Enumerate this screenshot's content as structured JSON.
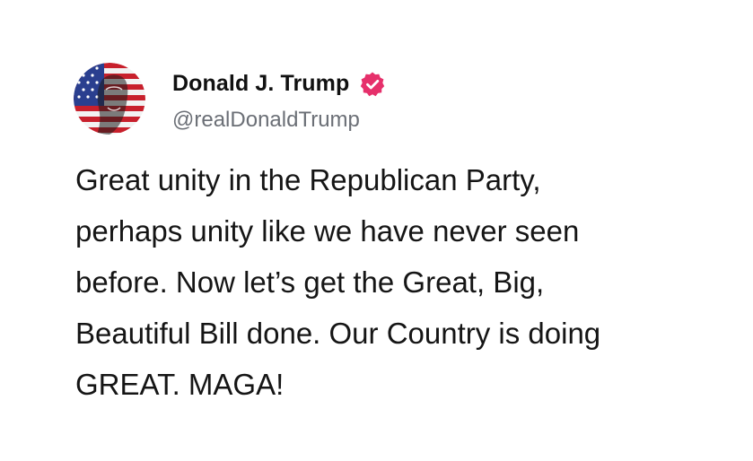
{
  "post": {
    "author": {
      "display_name": "Donald J. Trump",
      "handle": "@realDonaldTrump",
      "avatar_icon": "flag-portrait-avatar",
      "verified_icon": "verified-badge-icon",
      "verified_color": "#e6306b"
    },
    "text": "Great unity in the Republican Party,\nperhaps unity like we have never seen\nbefore. Now let’s get the Great, Big,\nBeautiful Bill done. Our Country is doing\nGREAT. MAGA!"
  }
}
